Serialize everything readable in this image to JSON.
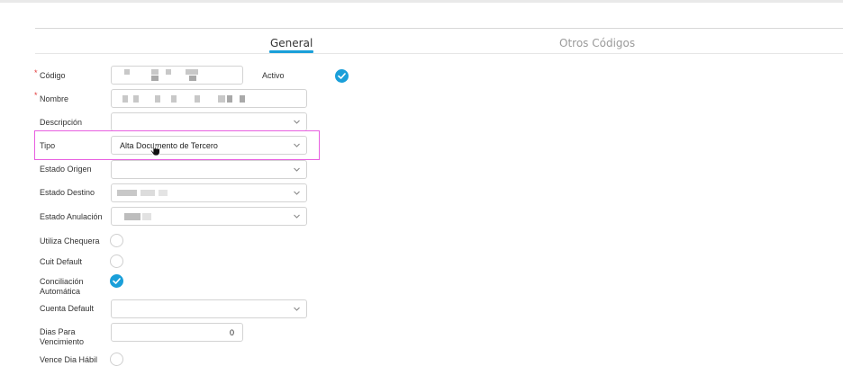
{
  "tabs": [
    {
      "label": "General",
      "active": true
    },
    {
      "label": "Otros Códigos",
      "active": false
    }
  ],
  "form": {
    "codigo_label": "Código",
    "activo_label": "Activo",
    "activo_checked": true,
    "nombre_label": "Nombre",
    "descripcion_label": "Descripción",
    "tipo_label": "Tipo",
    "tipo_value": "Alta Documento de Tercero",
    "estado_origen_label": "Estado Origen",
    "estado_destino_label": "Estado Destino",
    "estado_anulacion_label": "Estado Anulación",
    "utiliza_chequera_label": "Utiliza Chequera",
    "utiliza_chequera_checked": false,
    "cuit_default_label": "Cuit Default",
    "cuit_default_checked": false,
    "conciliacion_label_1": "Conciliación",
    "conciliacion_label_2": "Automática",
    "conciliacion_checked": true,
    "cuenta_default_label": "Cuenta Default",
    "dias_vencimiento_label_1": "Dias Para",
    "dias_vencimiento_label_2": "Vencimiento",
    "dias_vencimiento_value": "0",
    "vence_dia_habil_label": "Vence Dia Hábil",
    "required_mark": "*"
  },
  "colors": {
    "accent": "#1a9fd9",
    "required": "#e23b3b",
    "highlight": "#e85fe0"
  },
  "icons": {
    "dropdown": "chevron-down-icon",
    "checked": "check-circle-icon",
    "cursor": "hand-pointer-icon"
  }
}
